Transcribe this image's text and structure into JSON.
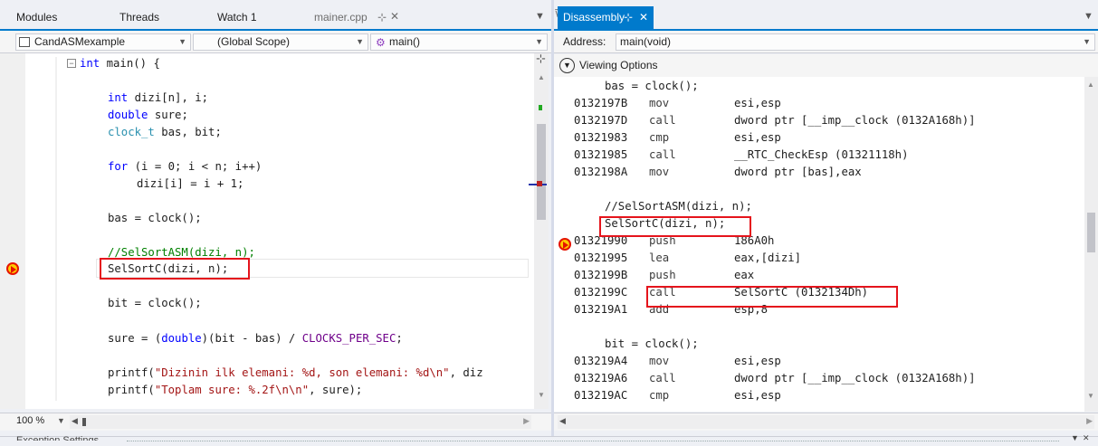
{
  "left": {
    "tabs": [
      {
        "label": "Modules"
      },
      {
        "label": "Threads"
      },
      {
        "label": "Watch 1"
      },
      {
        "label": "mainer.cpp"
      }
    ],
    "nav": {
      "project": "CandASMexample",
      "scope": "(Global Scope)",
      "function": "main()"
    },
    "code_lines": [
      {
        "t": "int main() {"
      },
      {
        "t": "int dizi[n], i;"
      },
      {
        "t": "double sure;"
      },
      {
        "t": "clock_t bas, bit;"
      },
      {
        "t": "for (i = 0; i < n; i++)"
      },
      {
        "t": "dizi[i] = i + 1;"
      },
      {
        "t": "bas = clock();"
      },
      {
        "t": "//SelSortASM(dizi, n);"
      },
      {
        "t": "SelSortC(dizi, n);"
      },
      {
        "t": "bit = clock();"
      },
      {
        "t": "sure = (double)(bit - bas) / CLOCKS_PER_SEC;"
      },
      {
        "t": "printf(\"Dizinin ilk elemani: %d, son elemani: %d\\n\", diz"
      },
      {
        "t": "printf(\"Toplam sure: %.2f\\n\\n\", sure);"
      }
    ],
    "zoom": "100 %"
  },
  "right": {
    "tab": "Disassembly",
    "address_label": "Address:",
    "address_value": "main(void)",
    "viewing_options": "Viewing Options",
    "lines": [
      {
        "src": "bas = clock();"
      },
      {
        "addr": "0132197B",
        "op": "mov",
        "arg": "esi,esp"
      },
      {
        "addr": "0132197D",
        "op": "call",
        "arg": "dword ptr [__imp__clock (0132A168h)]"
      },
      {
        "addr": "01321983",
        "op": "cmp",
        "arg": "esi,esp"
      },
      {
        "addr": "01321985",
        "op": "call",
        "arg": "__RTC_CheckEsp (01321118h)"
      },
      {
        "addr": "0132198A",
        "op": "mov",
        "arg": "dword ptr [bas],eax"
      },
      {
        "src": "//SelSortASM(dizi, n);"
      },
      {
        "src": "SelSortC(dizi, n);"
      },
      {
        "addr": "01321990",
        "op": "push",
        "arg": "186A0h"
      },
      {
        "addr": "01321995",
        "op": "lea",
        "arg": "eax,[dizi]"
      },
      {
        "addr": "0132199B",
        "op": "push",
        "arg": "eax"
      },
      {
        "addr": "0132199C",
        "op": "call",
        "arg": "SelSortC (0132134Dh)"
      },
      {
        "addr": "013219A1",
        "op": "add",
        "arg": "esp,8"
      },
      {
        "src": "bit = clock();"
      },
      {
        "addr": "013219A4",
        "op": "mov",
        "arg": "esi,esp"
      },
      {
        "addr": "013219A6",
        "op": "call",
        "arg": "dword ptr [__imp__clock (0132A168h)]"
      },
      {
        "addr": "013219AC",
        "op": "cmp",
        "arg": "esi,esp"
      }
    ]
  },
  "bottom": {
    "panel_title": "Exception Settings"
  }
}
